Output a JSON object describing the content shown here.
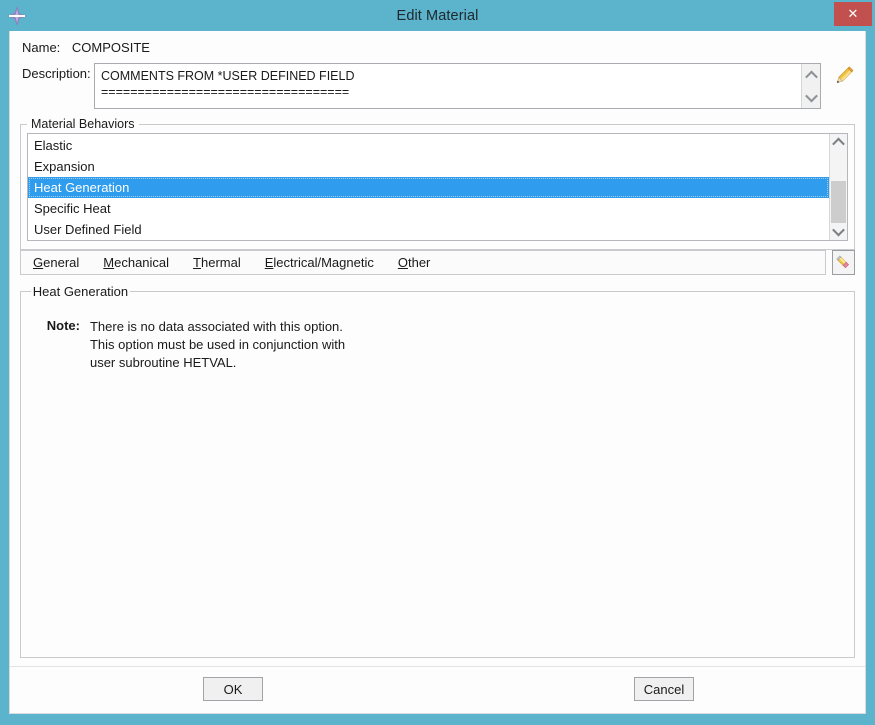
{
  "window": {
    "title": "Edit Material",
    "app_icon": "abaqus-diamond-icon",
    "close_label": "✕",
    "titlebar_color": "#5cb3cc",
    "close_button_color": "#c1504e"
  },
  "form": {
    "name_label": "Name:",
    "name_value": "COMPOSITE",
    "description_label": "Description:",
    "description_value": "COMMENTS FROM *USER DEFINED FIELD\n==================================",
    "edit_description_icon": "pencil-icon"
  },
  "behaviors": {
    "group_label": "Material Behaviors",
    "items": [
      {
        "label": "Elastic",
        "selected": false
      },
      {
        "label": "Expansion",
        "selected": false
      },
      {
        "label": "Heat Generation",
        "selected": true
      },
      {
        "label": "Specific Heat",
        "selected": false
      },
      {
        "label": "User Defined Field",
        "selected": false
      }
    ],
    "selection_color": "#2f9ced",
    "scroll_up_icon": "chevron-up-icon",
    "scroll_down_icon": "chevron-down-icon"
  },
  "menu": {
    "items": [
      {
        "mnemonic": "G",
        "rest": "eneral"
      },
      {
        "mnemonic": "M",
        "rest": "echanical"
      },
      {
        "mnemonic": "T",
        "rest": "hermal"
      },
      {
        "mnemonic": "E",
        "rest": "lectrical/Magnetic"
      },
      {
        "mnemonic": "O",
        "rest": "ther"
      }
    ],
    "edit_button_icon": "pencil-eraser-icon"
  },
  "detail": {
    "group_label": "Heat Generation",
    "note_key": "Note:",
    "note_lines": [
      "There is no data associated with this option.",
      "This option must be used in conjunction with",
      "user subroutine HETVAL."
    ]
  },
  "footer": {
    "ok_label": "OK",
    "cancel_label": "Cancel"
  }
}
